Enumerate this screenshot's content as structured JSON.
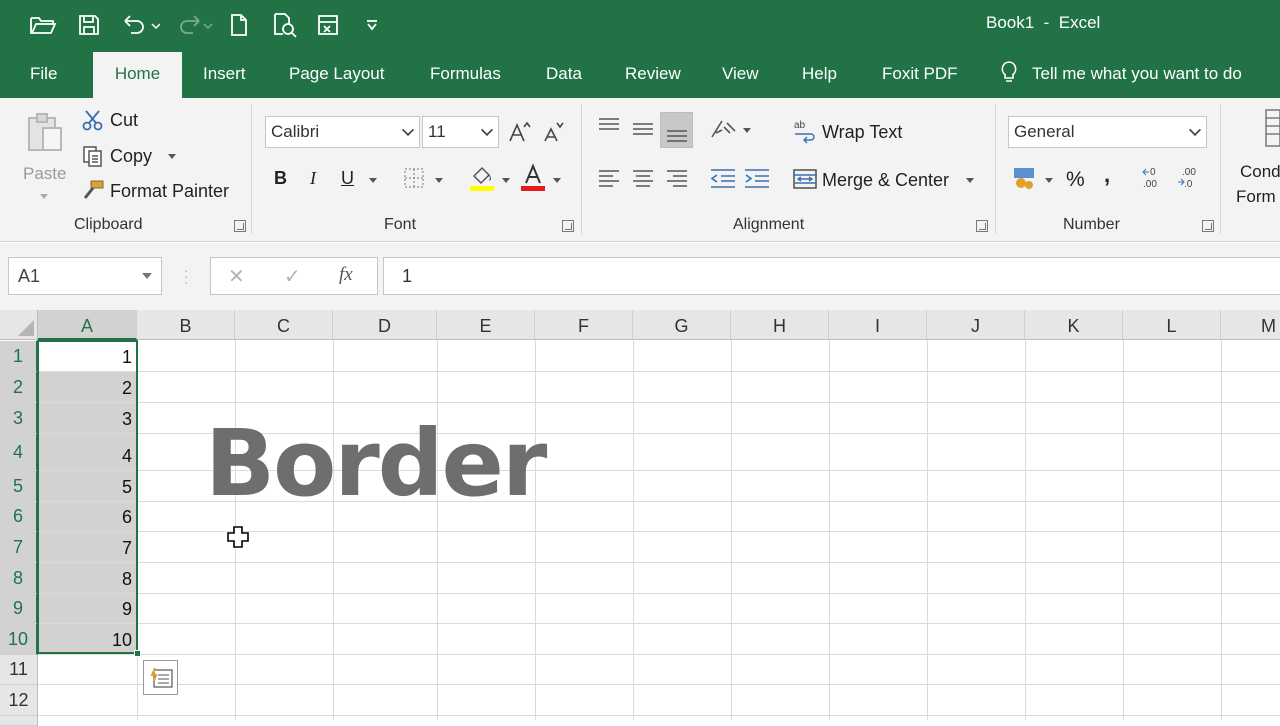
{
  "app": {
    "title": "Book1  -  Excel",
    "accent": "#217346"
  },
  "quick_access": [
    {
      "icon": "open-folder-icon"
    },
    {
      "icon": "save-icon"
    },
    {
      "icon": "undo-icon"
    },
    {
      "icon": "redo-icon"
    },
    {
      "icon": "new-document-icon"
    },
    {
      "icon": "print-preview-icon"
    },
    {
      "icon": "custom-form-icon"
    },
    {
      "icon": "customize-qat-icon"
    }
  ],
  "tabs": [
    {
      "label": "File"
    },
    {
      "label": "Home",
      "active": true
    },
    {
      "label": "Insert"
    },
    {
      "label": "Page Layout"
    },
    {
      "label": "Formulas"
    },
    {
      "label": "Data"
    },
    {
      "label": "Review"
    },
    {
      "label": "View"
    },
    {
      "label": "Help"
    },
    {
      "label": "Foxit PDF"
    }
  ],
  "tell_me": "Tell me what you want to do",
  "ribbon": {
    "clipboard": {
      "label": "Clipboard",
      "paste": "Paste",
      "cut": "Cut",
      "copy": "Copy",
      "format_painter": "Format Painter"
    },
    "font": {
      "label": "Font",
      "font_name": "Calibri",
      "font_size": "11",
      "bold": "B",
      "italic": "I",
      "underline": "U",
      "font_color": "#e21b1b",
      "highlight_color": "#ffff00"
    },
    "alignment": {
      "label": "Alignment",
      "wrap_text": "Wrap Text",
      "merge_center": "Merge & Center"
    },
    "number": {
      "label": "Number",
      "format": "General",
      "percent": "%",
      "comma": ","
    },
    "conditional": {
      "line1": "Cond",
      "line2": "Form"
    }
  },
  "formula_bar": {
    "name_box": "A1",
    "cancel": "✕",
    "enter": "✓",
    "fx": "fx",
    "value": "1"
  },
  "sheet": {
    "columns": [
      "A",
      "B",
      "C",
      "D",
      "E",
      "F",
      "G",
      "H",
      "I",
      "J",
      "K",
      "L",
      "M"
    ],
    "rows": [
      "1",
      "2",
      "3",
      "4",
      "5",
      "6",
      "7",
      "8",
      "9",
      "10",
      "11",
      "12"
    ],
    "column_a_values": [
      "1",
      "2",
      "3",
      "4",
      "5",
      "6",
      "7",
      "8",
      "9",
      "10"
    ],
    "selected_column": "A"
  },
  "overlay_text": "Border"
}
